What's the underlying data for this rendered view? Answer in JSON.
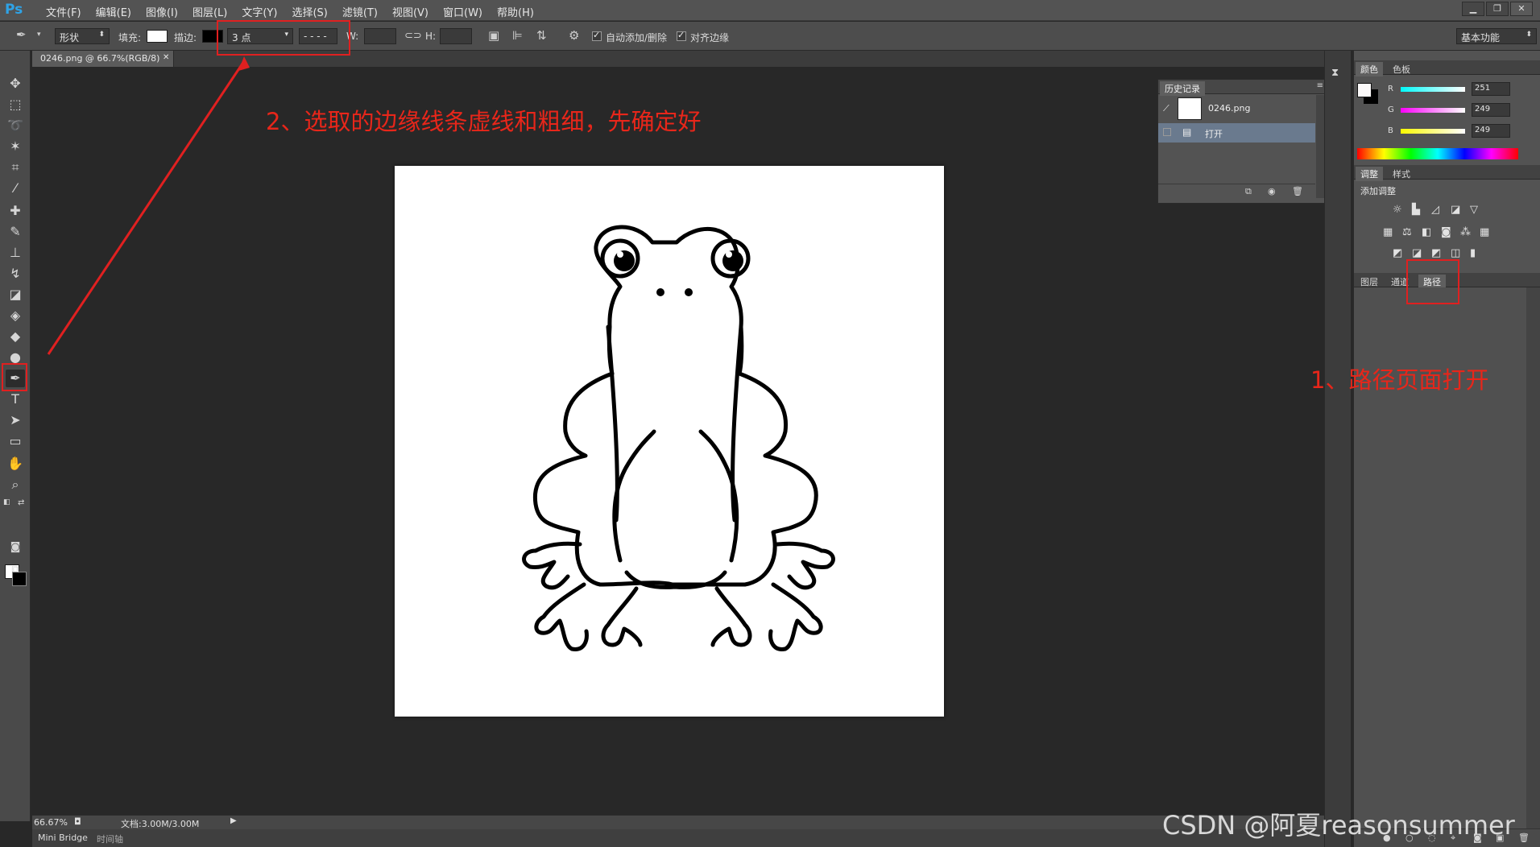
{
  "app": {
    "logo": "Ps"
  },
  "menu": [
    "文件(F)",
    "编辑(E)",
    "图像(I)",
    "图层(L)",
    "文字(Y)",
    "选择(S)",
    "滤镜(T)",
    "视图(V)",
    "窗口(W)",
    "帮助(H)"
  ],
  "options": {
    "mode": "形状",
    "fill_label": "填充:",
    "stroke_label": "描边:",
    "stroke_width": "3 点",
    "stroke_style": "- - - -",
    "w_label": "W:",
    "h_label": "H:",
    "auto_add_delete": "自动添加/删除",
    "align_edges": "对齐边缘",
    "workspace": "基本功能"
  },
  "document": {
    "tab_title": "0246.png @ 66.7%(RGB/8)"
  },
  "status": {
    "zoom": "66.67%",
    "doc_info": "文档:3.00M/3.00M"
  },
  "bottom_tabs": [
    "Mini Bridge",
    "时间轴"
  ],
  "history": {
    "tabs": [
      "历史记录"
    ],
    "snapshot": "0246.png",
    "items": [
      "打开"
    ]
  },
  "color_panel": {
    "tabs": [
      "颜色",
      "色板"
    ],
    "r_label": "R",
    "g_label": "G",
    "b_label": "B",
    "r": "251",
    "g": "249",
    "b": "249"
  },
  "adjust_panel": {
    "tabs": [
      "调整",
      "样式"
    ],
    "title": "添加调整"
  },
  "layers_panel": {
    "tabs": [
      "图层",
      "通道",
      "路径"
    ]
  },
  "annotations": {
    "step2": "2、选取的边缘线条虚线和粗细，先确定好",
    "step1": "1、路径页面打开"
  },
  "watermark": "CSDN @阿夏reasonsummer",
  "colors": {
    "annotation": "#e02020",
    "ps_blue": "#2fa3e6"
  }
}
